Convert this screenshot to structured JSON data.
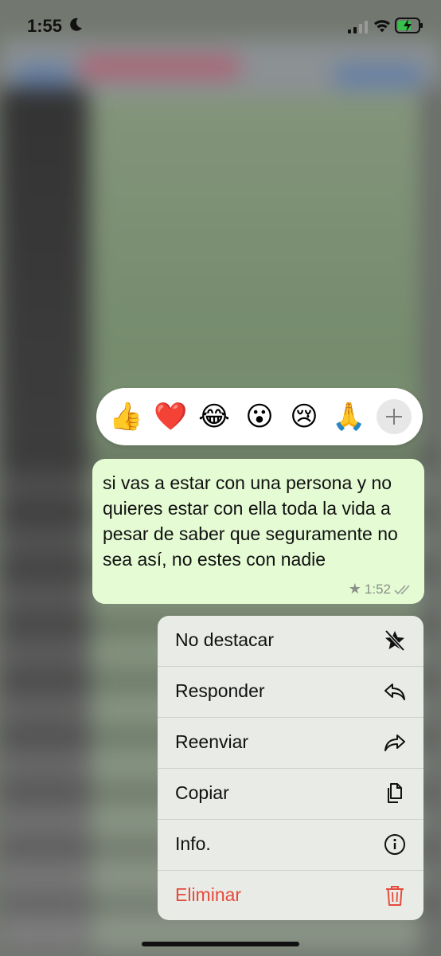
{
  "status_bar": {
    "time": "1:55",
    "icons": [
      "moon-icon",
      "signal-icon",
      "wifi-icon",
      "battery-charging-icon"
    ]
  },
  "reactions": [
    {
      "name": "thumbs-up",
      "glyph": "👍"
    },
    {
      "name": "red-heart",
      "glyph": "❤️"
    },
    {
      "name": "tears-of-joy",
      "glyph": "😂"
    },
    {
      "name": "surprised",
      "glyph": "😮"
    },
    {
      "name": "crying",
      "glyph": "😢"
    },
    {
      "name": "praying-hands",
      "glyph": "🙏"
    }
  ],
  "message": {
    "text": "si vas a estar con una persona y no quieres estar con ella toda la vida a pesar de saber que seguramente no sea así, no estes con nadie",
    "time": "1:52",
    "starred": true,
    "read_ticks": "double-check-icon"
  },
  "menu": {
    "items": [
      {
        "label": "No destacar",
        "icon": "unstar-icon"
      },
      {
        "label": "Responder",
        "icon": "reply-icon"
      },
      {
        "label": "Reenviar",
        "icon": "forward-icon"
      },
      {
        "label": "Copiar",
        "icon": "copy-icon"
      },
      {
        "label": "Info.",
        "icon": "info-icon"
      },
      {
        "label": "Eliminar",
        "icon": "trash-icon",
        "danger": true
      }
    ]
  },
  "colors": {
    "bubble": "#e4fbd4",
    "menu_bg": "#e9ebe6",
    "danger": "#e64a3d"
  }
}
